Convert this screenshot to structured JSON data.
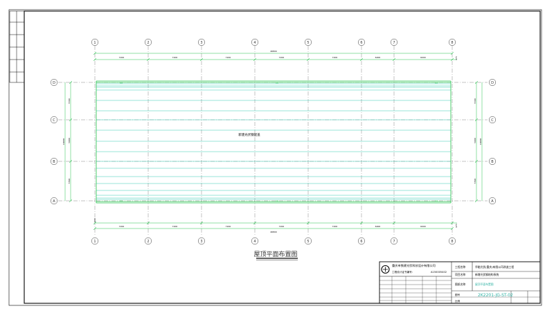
{
  "drawing": {
    "caption": "屋顶平面布置图",
    "roof_label": "新建光伏钢屋盖",
    "grid_columns": [
      "1",
      "2",
      "3",
      "4",
      "5",
      "6",
      "7",
      "8"
    ],
    "grid_rows": [
      "D",
      "C",
      "B",
      "A"
    ],
    "bay_dims_top": [
      "7200",
      "7200",
      "7200",
      "7200",
      "7200",
      "6000",
      "6000"
    ],
    "bay_dims_bottom": [
      "7200",
      "7200",
      "7200",
      "7200",
      "7200",
      "6000",
      "6000"
    ],
    "overall_dim_top": "46800",
    "overall_dim_bottom": "46800",
    "end_dim_top": "475",
    "end_dim_bottom": "475",
    "bottom_left_dim": "200",
    "left_dims": [
      "5500",
      "5000",
      "5500"
    ],
    "left_total_dim": "16000",
    "right_dims": [
      "5500",
      "5000",
      "5500"
    ],
    "right_total_dim": "16000"
  },
  "title_block": {
    "company": "重庆市铁建光伏科技设计有限公司",
    "cert_label": "工程设计证书编号：",
    "cert_no": "A150005402",
    "project_label": "工程名称",
    "project": "华能光伏(重庆)有限公司改造工程",
    "item_label": "项目名称",
    "item": "新增光伏钢结构系统",
    "drawing_label": "图纸名称",
    "drawing_name": "屋顶平面布置图",
    "drawing_no_label": "图号",
    "drawing_no": "2K2201-JG-ST-02",
    "scale_label": "比例"
  }
}
